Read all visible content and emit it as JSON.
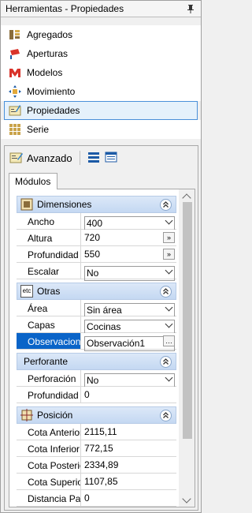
{
  "title": "Herramientas - Propiedades",
  "nav": {
    "items": [
      {
        "label": "Agregados",
        "icon": "aggregates-icon"
      },
      {
        "label": "Aperturas",
        "icon": "openings-icon"
      },
      {
        "label": "Modelos",
        "icon": "models-icon"
      },
      {
        "label": "Movimiento",
        "icon": "movement-icon"
      },
      {
        "label": "Propiedades",
        "icon": "properties-icon",
        "selected": true
      },
      {
        "label": "Serie",
        "icon": "series-icon"
      }
    ]
  },
  "toolbar": {
    "avanzado_label": "Avanzado"
  },
  "tab": {
    "label": "Módulos"
  },
  "sections": {
    "dimensiones": {
      "title": "Dimensiones",
      "rows": [
        {
          "label": "Ancho",
          "value": "400"
        },
        {
          "label": "Altura",
          "value": "720"
        },
        {
          "label": "Profundidad",
          "value": "550"
        },
        {
          "label": "Escalar",
          "value": "No"
        }
      ]
    },
    "otras": {
      "title": "Otras",
      "icon_text": "etc",
      "rows": [
        {
          "label": "Área",
          "value": "Sin área"
        },
        {
          "label": "Capas",
          "value": "Cocinas"
        },
        {
          "label": "Observaciones",
          "value": "Observación1"
        }
      ]
    },
    "perforante": {
      "title": "Perforante",
      "rows": [
        {
          "label": "Perforación",
          "value": "No"
        },
        {
          "label": "Profundidad",
          "value": "0"
        }
      ]
    },
    "posicion": {
      "title": "Posición",
      "rows": [
        {
          "label": "Cota Anterior",
          "value": "2115,11"
        },
        {
          "label": "Cota Inferior",
          "value": "772,15"
        },
        {
          "label": "Cota Posterior",
          "value": "2334,89"
        },
        {
          "label": "Cota Superior",
          "value": "1107,85"
        },
        {
          "label": "Distancia Par...",
          "value": "0"
        }
      ]
    }
  },
  "colors": {
    "selection": "#0a64c8",
    "section_header": "#c4d8f2",
    "nav_selected": "#e5f1fb"
  }
}
